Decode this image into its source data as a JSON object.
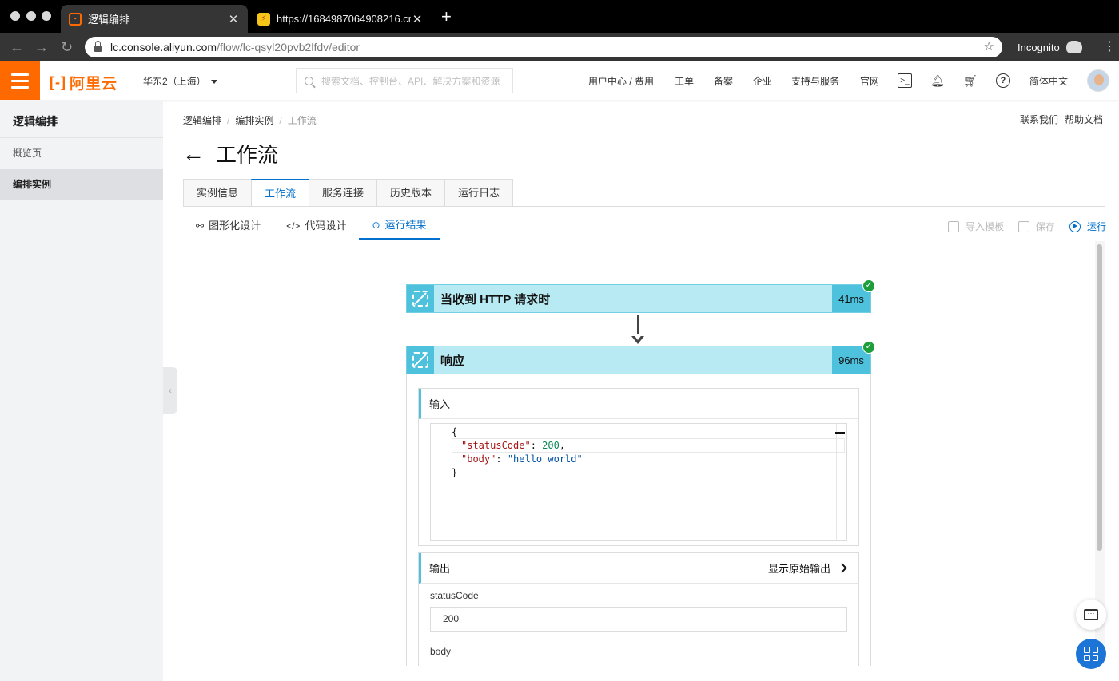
{
  "browser": {
    "tabs": [
      {
        "title": "逻辑编排",
        "close": "✕"
      },
      {
        "title": "https://1684987064908216.cn",
        "close": "✕"
      }
    ],
    "new_tab": "+",
    "url_host": "lc.console.aliyun.com",
    "url_path": "/flow/lc-qsyl20pvb2lfdv/editor",
    "incognito_label": "Incognito"
  },
  "header": {
    "logo_text": "阿里云",
    "region": "华东2（上海）",
    "search_placeholder": "搜索文档、控制台、API、解决方案和资源",
    "nav": [
      "用户中心 / 费用",
      "工单",
      "备案",
      "企业",
      "支持与服务",
      "官网"
    ],
    "language": "简体中文",
    "brand_color": "#ff6a00"
  },
  "sidebar": {
    "title": "逻辑编排",
    "items": [
      {
        "label": "概览页",
        "active": false
      },
      {
        "label": "编排实例",
        "active": true
      }
    ]
  },
  "breadcrumb": [
    "逻辑编排",
    "编排实例",
    "工作流"
  ],
  "top_links": [
    "联系我们",
    "帮助文档"
  ],
  "page_title": "工作流",
  "tabs": [
    "实例信息",
    "工作流",
    "服务连接",
    "历史版本",
    "运行日志"
  ],
  "active_tab": "工作流",
  "subtabs": [
    "图形化设计",
    "代码设计",
    "运行结果"
  ],
  "active_subtab": "运行结果",
  "actions": [
    {
      "label": "导入模板",
      "enabled": false
    },
    {
      "label": "保存",
      "enabled": false
    },
    {
      "label": "运行",
      "enabled": true
    }
  ],
  "flow": {
    "nodes": [
      {
        "label": "当收到 HTTP 请求时",
        "duration": "41ms",
        "status": "success"
      },
      {
        "label": "响应",
        "duration": "96ms",
        "status": "success"
      }
    ],
    "input_title": "输入",
    "input_code": {
      "open": "{",
      "line1_key": "\"statusCode\"",
      "line1_sep": ": ",
      "line1_val": "200",
      "line1_end": ",",
      "line2_key": "\"body\"",
      "line2_sep": ": ",
      "line2_val": "\"hello world\"",
      "close": "}"
    },
    "output_title": "输出",
    "raw_output_link": "显示原始输出",
    "fields": [
      {
        "label": "statusCode",
        "value": "200"
      },
      {
        "label": "body"
      }
    ],
    "accent_color": "#4ec1dc"
  }
}
